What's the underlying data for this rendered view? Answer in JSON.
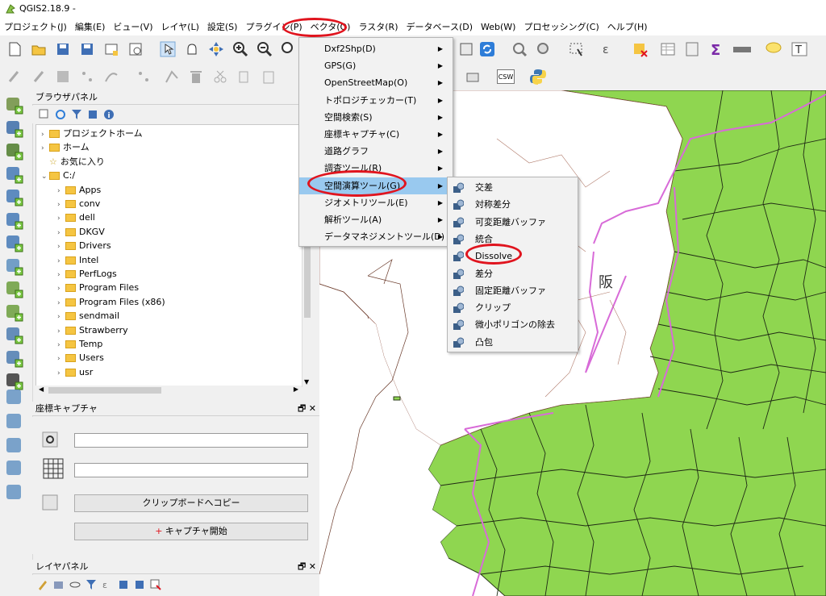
{
  "window": {
    "title": "QGIS2.18.9 -"
  },
  "menubar": [
    "プロジェクト(J)",
    "編集(E)",
    "ビュー(V)",
    "レイヤ(L)",
    "設定(S)",
    "プラグイン(P)",
    "ベクタ(O)",
    "ラスタ(R)",
    "データベース(D)",
    "Web(W)",
    "プロセッシング(C)",
    "ヘルプ(H)"
  ],
  "vector_menu": [
    {
      "label": "Dxf2Shp(D)",
      "sub": true
    },
    {
      "label": "GPS(G)",
      "sub": true
    },
    {
      "label": "OpenStreetMap(O)",
      "sub": true
    },
    {
      "label": "トポロジチェッカー(T)",
      "sub": true
    },
    {
      "label": "空間検索(S)",
      "sub": true
    },
    {
      "label": "座標キャプチャ(C)",
      "sub": true
    },
    {
      "label": "道路グラフ",
      "sub": true
    },
    {
      "label": "調査ツール(R)",
      "sub": true
    },
    {
      "label": "空間演算ツール(G)",
      "sub": true
    },
    {
      "label": "ジオメトリツール(E)",
      "sub": true
    },
    {
      "label": "解析ツール(A)",
      "sub": true
    },
    {
      "label": "データマネジメントツール(D)",
      "sub": true
    }
  ],
  "geoprocessing_menu": [
    "交差",
    "対称差分",
    "可変距離バッファ",
    "統合",
    "Dissolve",
    "差分",
    "固定距離バッファ",
    "クリップ",
    "微小ポリゴンの除去",
    "凸包"
  ],
  "browser_panel": {
    "title": "ブラウザパネル",
    "items": [
      {
        "label": "プロジェクトホーム",
        "type": "folder",
        "indent": 0
      },
      {
        "label": "ホーム",
        "type": "folder",
        "indent": 0
      },
      {
        "label": "お気に入り",
        "type": "star",
        "indent": 0
      },
      {
        "label": "C:/",
        "type": "folder",
        "indent": 0,
        "open": true
      },
      {
        "label": "Apps",
        "type": "folder",
        "indent": 1
      },
      {
        "label": "conv",
        "type": "folder",
        "indent": 1
      },
      {
        "label": "dell",
        "type": "folder",
        "indent": 1
      },
      {
        "label": "DKGV",
        "type": "folder",
        "indent": 1
      },
      {
        "label": "Drivers",
        "type": "folder",
        "indent": 1
      },
      {
        "label": "Intel",
        "type": "folder",
        "indent": 1
      },
      {
        "label": "PerfLogs",
        "type": "folder",
        "indent": 1
      },
      {
        "label": "Program Files",
        "type": "folder",
        "indent": 1
      },
      {
        "label": "Program Files (x86)",
        "type": "folder",
        "indent": 1
      },
      {
        "label": "sendmail",
        "type": "folder",
        "indent": 1
      },
      {
        "label": "Strawberry",
        "type": "folder",
        "indent": 1
      },
      {
        "label": "Temp",
        "type": "folder",
        "indent": 1
      },
      {
        "label": "Users",
        "type": "folder",
        "indent": 1
      },
      {
        "label": "usr",
        "type": "folder",
        "indent": 1
      }
    ]
  },
  "coord_panel": {
    "title": "座標キャプチャ",
    "copy_button": "クリップボードへコピー",
    "start_button": "キャプチャ開始",
    "field1": "",
    "field2": ""
  },
  "layer_panel": {
    "title": "レイヤパネル"
  },
  "map": {
    "label": "阪",
    "land_color": "#8fd650",
    "boundary_color": "#d86bd8"
  },
  "toolbar": {
    "csw_label": "CSW"
  }
}
